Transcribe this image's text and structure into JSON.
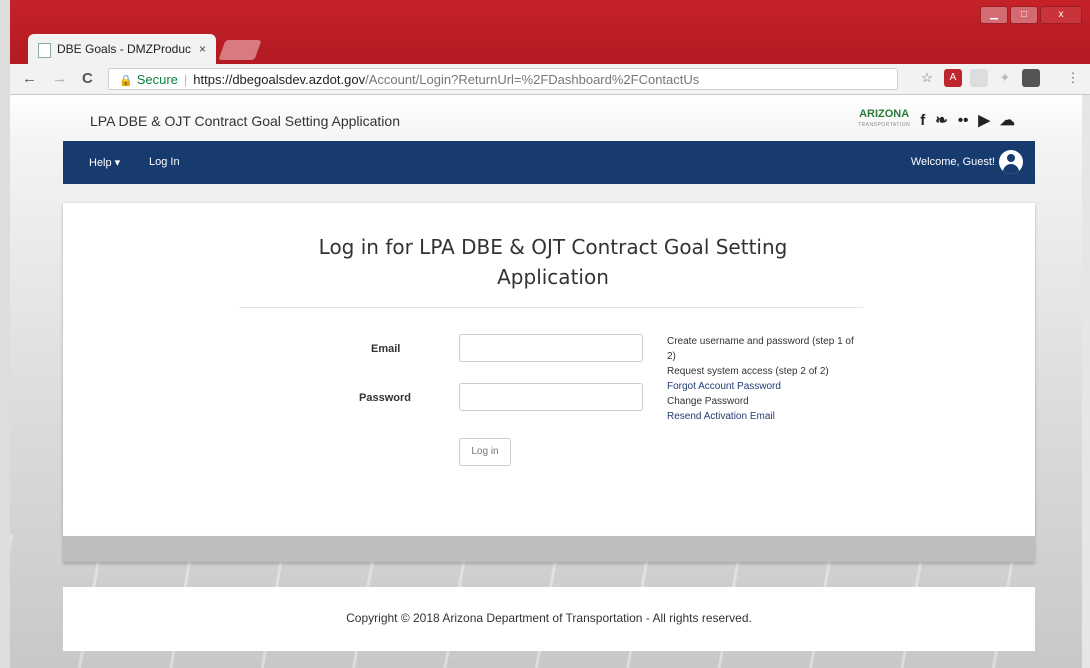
{
  "browser": {
    "tab_title": "DBE Goals - DMZProduc",
    "tab_close": "×",
    "nav_back": "←",
    "nav_forward": "→",
    "nav_reload": "C",
    "secure_label": "Secure",
    "url_host": "https://dbegoalsdev.azdot.gov",
    "url_path": "/Account/Login?ReturnUrl=%2FDashboard%2FContactUs",
    "star_icon": "☆",
    "menu_icon": "⋮",
    "window_buttons": [
      "▁",
      "□",
      "x"
    ]
  },
  "header": {
    "app_title": "LPA DBE & OJT Contract Goal Setting Application",
    "logo_text": "ARIZONA",
    "logo_subtext": "TRANSPORTATION",
    "social_icons": [
      "f",
      "❧",
      "••",
      "▶",
      "☁"
    ]
  },
  "navbar": {
    "help_label": "Help ▾",
    "login_label": "Log In",
    "welcome_label": "Welcome, Guest!"
  },
  "login": {
    "title": "Log in for LPA DBE & OJT Contract Goal Setting Application",
    "email_label": "Email",
    "email_value": "",
    "password_label": "Password",
    "password_value": "",
    "submit_label": "Log in",
    "links": {
      "create": "Create username and password (step 1 of 2)",
      "request": "Request system access (step 2 of 2)",
      "forgot": "Forgot Account Password",
      "change": "Change Password",
      "resend": "Resend Activation Email"
    }
  },
  "footer": {
    "copyright": "Copyright © 2018 Arizona Department of Transportation - All rights reserved."
  },
  "colors": {
    "navbar_bg": "#173a6f",
    "link": "#1f3c73",
    "chrome_frame": "#c52228"
  }
}
